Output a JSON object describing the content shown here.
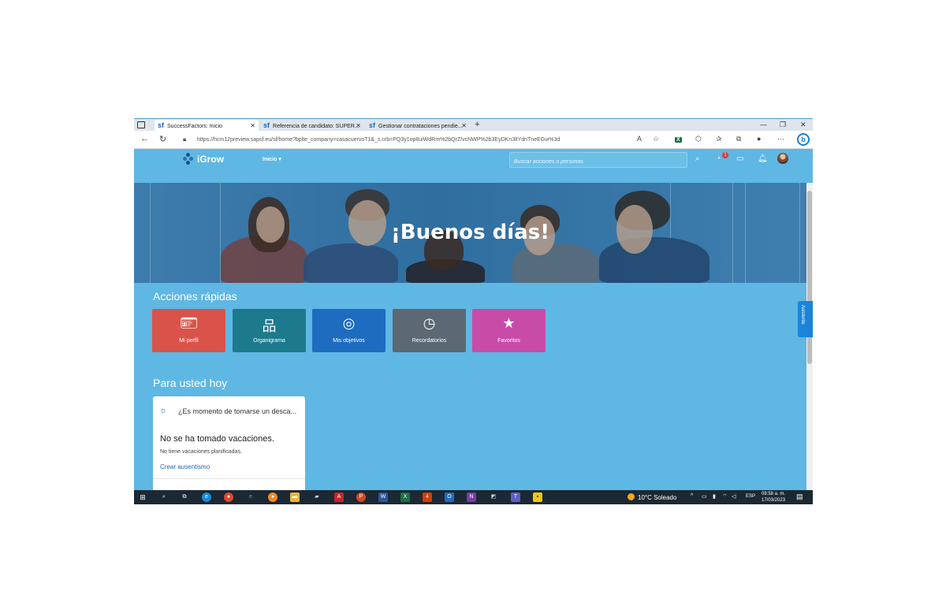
{
  "browser": {
    "tabs": [
      {
        "favicon": "sf",
        "title": "SuccessFactors: Inicio",
        "active": true
      },
      {
        "favicon": "sf",
        "title": "Referencia de candidato: SUPER...",
        "active": false
      },
      {
        "favicon": "sf",
        "title": "Gestionar contrataciones pendie...",
        "active": false
      }
    ],
    "new_tab_label": "+",
    "url": "https://hcm12preview.sapsf.eu/sf/home?bplte_company=casacuervoT1&_s.crb=PQ3y1op8uiWdRm%2bQrZ/vcNWP%2b3EyDKn3ltYdnTneEGw%3d"
  },
  "header": {
    "logo": "iGrow",
    "nav_home": "Inicio",
    "search_placeholder": "Buscar acciones o personas",
    "notification_count": "1"
  },
  "hero": {
    "greeting": "¡Buenos días!"
  },
  "quick_actions": {
    "title": "Acciones rápidas",
    "items": [
      {
        "label": "Mi perfil",
        "icon": "id-card-icon",
        "color": "#d9534a"
      },
      {
        "label": "Organigrama",
        "icon": "org-chart-icon",
        "color": "#1c7a8c"
      },
      {
        "label": "Mis objetivos",
        "icon": "target-icon",
        "color": "#1e6cbf"
      },
      {
        "label": "Recordatorios",
        "icon": "reminder-icon",
        "color": "#5c6873"
      },
      {
        "label": "Favoritos",
        "icon": "star-icon",
        "color": "#c94ba8"
      }
    ]
  },
  "for_you": {
    "title": "Para usted hoy",
    "card": {
      "title": "¿Es momento de tomarse un desca...",
      "main": "No se ha tomado vacaciones.",
      "sub": "No tiene vacaciones planificadas.",
      "link": "Crear ausentismo"
    }
  },
  "assistant_label": "Asistente",
  "taskbar": {
    "weather": "10°C Soleado",
    "language": "ESP",
    "time": "08:58 a. m.",
    "date": "17/03/2023"
  }
}
